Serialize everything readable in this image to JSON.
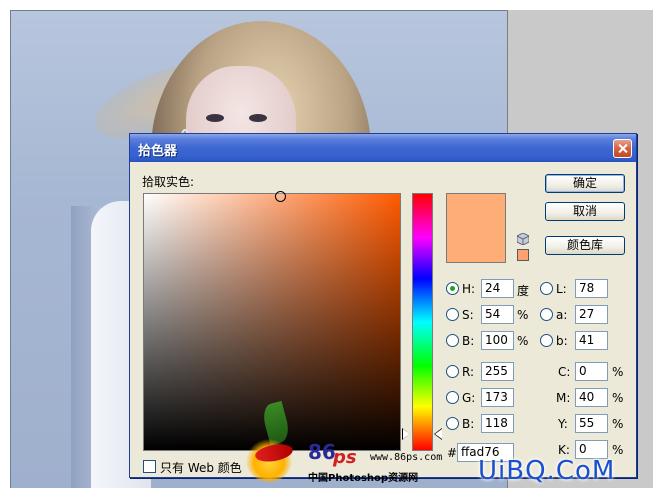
{
  "dialog": {
    "title": "拾色器",
    "pick_label": "拾取实色:",
    "buttons": {
      "ok": "确定",
      "cancel": "取消",
      "library": "颜色库"
    },
    "current_color": "#ffad76",
    "hue_slider_level": 24,
    "fields": {
      "H": {
        "label": "H:",
        "value": "24",
        "unit": "度",
        "selected": true
      },
      "S": {
        "label": "S:",
        "value": "54",
        "unit": "%"
      },
      "Bv": {
        "label": "B:",
        "value": "100",
        "unit": "%"
      },
      "R": {
        "label": "R:",
        "value": "255"
      },
      "G": {
        "label": "G:",
        "value": "173"
      },
      "Bb": {
        "label": "B:",
        "value": "118"
      },
      "L": {
        "label": "L:",
        "value": "78"
      },
      "a": {
        "label": "a:",
        "value": "27"
      },
      "b": {
        "label": "b:",
        "value": "41"
      },
      "C": {
        "label": "C:",
        "value": "0",
        "unit": "%"
      },
      "M": {
        "label": "M:",
        "value": "40",
        "unit": "%"
      },
      "Y": {
        "label": "Y:",
        "value": "55",
        "unit": "%"
      },
      "K": {
        "label": "K:",
        "value": "0",
        "unit": "%"
      }
    },
    "hex_label": "#",
    "hex_value": "ffad76",
    "web_only_label": "只有 Web 颜色"
  },
  "watermark": {
    "brand_86": "86",
    "brand_ps": "ps",
    "url": "www.86ps.com",
    "site_cn": "中国Photoshop资源网",
    "uibq": "UiBQ.CoM"
  },
  "icons": [
    "close-icon",
    "cube-icon",
    "radio-icon",
    "checkbox-icon",
    "slider-arrow-icon"
  ]
}
